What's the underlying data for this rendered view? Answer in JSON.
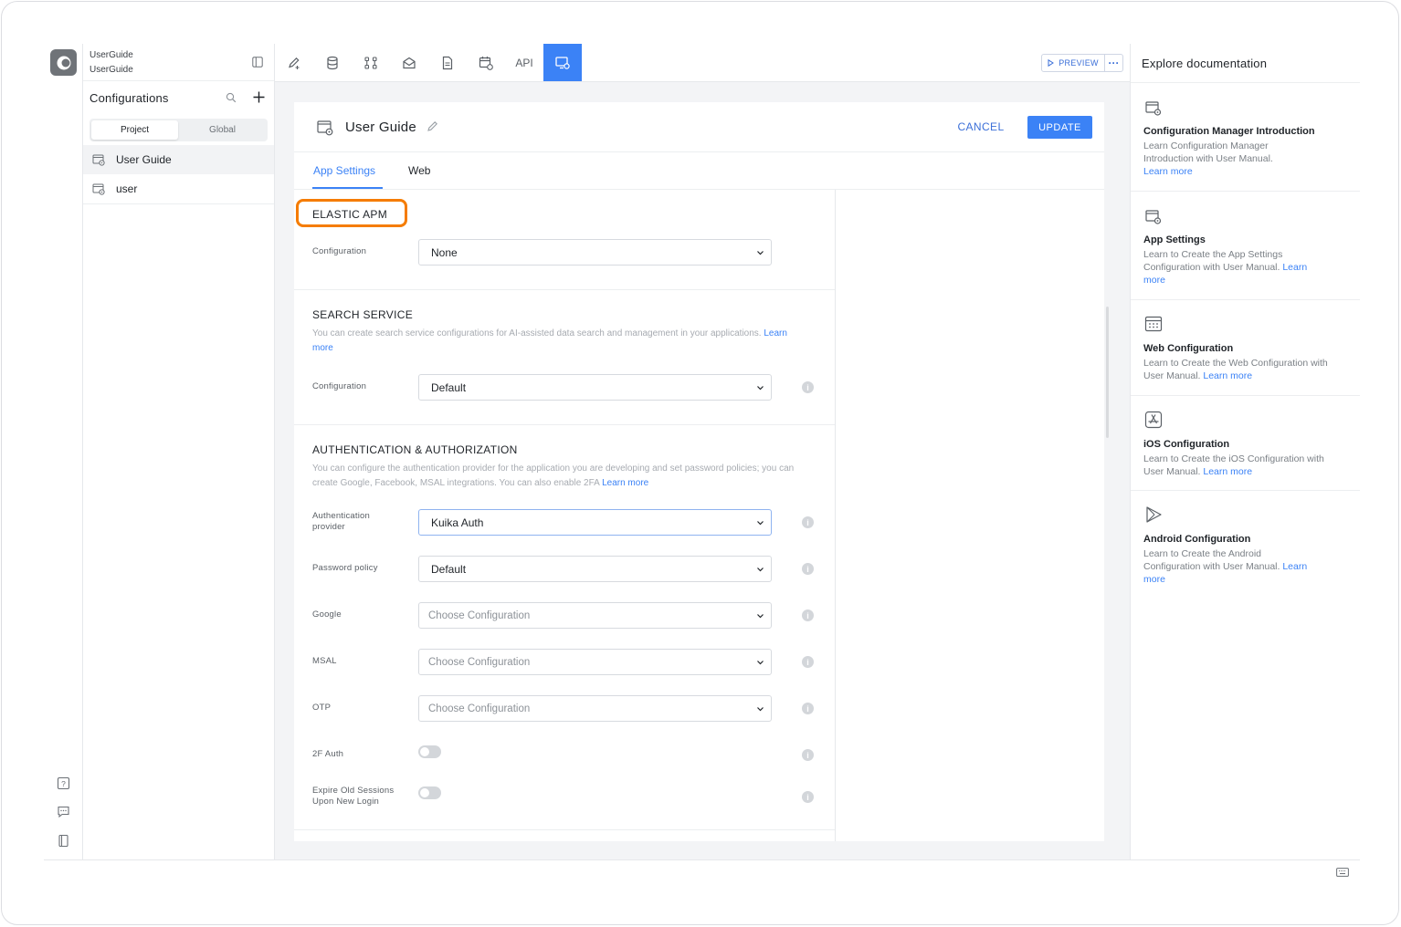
{
  "project": {
    "line1": "UserGuide",
    "line2": "UserGuide"
  },
  "sidebar": {
    "title": "Configurations",
    "segments": [
      "Project",
      "Global"
    ],
    "items": [
      {
        "label": "User Guide"
      },
      {
        "label": "user"
      }
    ]
  },
  "toolbar": {
    "icons": [
      "edit-add-icon",
      "database-icon",
      "workflow-icon",
      "message-icon",
      "document-icon",
      "calendar-icon"
    ],
    "api_label": "API",
    "preview_label": "PREVIEW",
    "more_label": "···"
  },
  "editor": {
    "title": "User Guide",
    "cancel_label": "CANCEL",
    "update_label": "UPDATE",
    "tabs": [
      "App Settings",
      "Web"
    ]
  },
  "sections": {
    "elastic": {
      "title": "ELASTIC APM",
      "config_label": "Configuration",
      "config_value": "None"
    },
    "search": {
      "title": "SEARCH SERVICE",
      "desc": "You can create search service configurations for AI-assisted data search and management in your applications.",
      "link": "Learn more",
      "config_label": "Configuration",
      "config_value": "Default"
    },
    "auth": {
      "title": "AUTHENTICATION & AUTHORIZATION",
      "desc": "You can configure the authentication provider for the application you are developing and set password policies; you can create Google, Facebook, MSAL integrations. You can also enable 2FA",
      "link": "Learn more",
      "fields": [
        {
          "label": "Authentication provider",
          "value": "Kuika Auth"
        },
        {
          "label": "Password policy",
          "value": "Default"
        },
        {
          "label": "Google",
          "value": "Choose Configuration"
        },
        {
          "label": "MSAL",
          "value": "Choose Configuration"
        },
        {
          "label": "OTP",
          "value": "Choose Configuration"
        }
      ],
      "toggles": [
        {
          "label": "2F Auth",
          "on": false
        },
        {
          "label": "Expire Old Sessions Upon New Login",
          "on": false
        }
      ]
    }
  },
  "docs": {
    "title": "Explore documentation",
    "link_label": "Learn more",
    "cards": [
      {
        "icon": "app-settings-icon",
        "name": "Configuration Manager Introduction",
        "desc": "Learn Configuration Manager Introduction with User Manual."
      },
      {
        "icon": "app-settings-icon",
        "name": "App Settings",
        "desc": "Learn to Create the App Settings Configuration with User Manual."
      },
      {
        "icon": "web-config-icon",
        "name": "Web Configuration",
        "desc": "Learn to Create the Web Configuration with User Manual."
      },
      {
        "icon": "ios-app-store-icon",
        "name": "iOS Configuration",
        "desc": "Learn to Create the iOS Configuration with User Manual."
      },
      {
        "icon": "android-play-icon",
        "name": "Android Configuration",
        "desc": "Learn to Create the Android Configuration with User Manual."
      }
    ]
  },
  "colors": {
    "accent": "#3b82f6",
    "highlight": "#f57c00"
  }
}
